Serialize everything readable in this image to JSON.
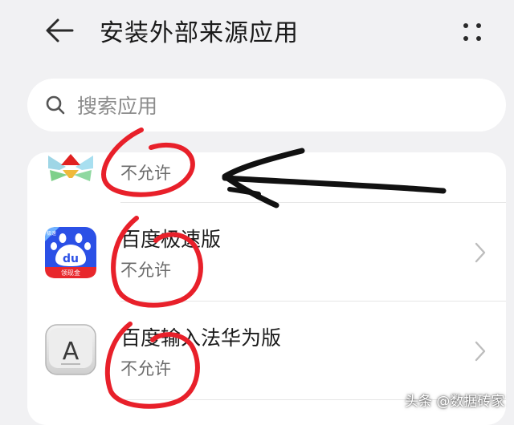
{
  "header": {
    "title": "安装外部来源应用",
    "back_icon": "arrow-left-icon",
    "more_icon": "more-dots-icon"
  },
  "search": {
    "placeholder": "搜索应用",
    "value": "",
    "icon": "search-icon"
  },
  "apps": [
    {
      "name": "",
      "status": "不允许",
      "icon": "app-icon"
    },
    {
      "name": "百度极速版",
      "status": "不允许",
      "icon": "baidu-lite-icon",
      "icon_text": "du",
      "badge_top": "极速",
      "badge_bottom": "领现金"
    },
    {
      "name": "百度输入法华为版",
      "status": "不允许",
      "icon": "baidu-input-icon",
      "icon_text": "A"
    }
  ],
  "colors": {
    "background": "#f1f1f3",
    "card": "#ffffff",
    "annotation_red": "#e8202a",
    "annotation_black": "#111111",
    "baidu_blue": "#2b50e6",
    "baidu_red": "#e8272c"
  },
  "watermark": "头条 @数据砖家"
}
